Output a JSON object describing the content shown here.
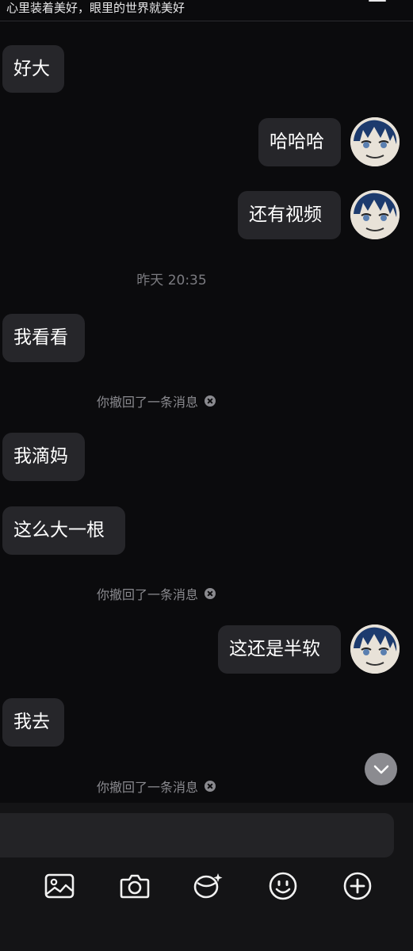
{
  "header": {
    "title": "心里装着美好，眼里的世界就美好"
  },
  "messages": [
    {
      "side": "left",
      "text": "好大"
    },
    {
      "side": "right",
      "text": "哈哈哈"
    },
    {
      "side": "right",
      "text": "还有视频"
    },
    {
      "type": "timestamp",
      "text": "昨天 20:35"
    },
    {
      "side": "left",
      "text": "我看看"
    },
    {
      "type": "system",
      "text": "你撤回了一条消息"
    },
    {
      "side": "left",
      "text": "我滴妈"
    },
    {
      "side": "left",
      "text": "这么大一根"
    },
    {
      "type": "system",
      "text": "你撤回了一条消息"
    },
    {
      "side": "right",
      "text": "这还是半软"
    },
    {
      "side": "left",
      "text": "我去"
    },
    {
      "type": "system",
      "text": "你撤回了一条消息"
    }
  ],
  "input": {
    "placeholder": ""
  },
  "toolbar": [
    "image-icon",
    "camera-icon",
    "sticker-icon",
    "emoji-icon",
    "plus-icon"
  ],
  "colors": {
    "background": "#0b0b0d",
    "bubble": "#26262a",
    "input_bar": "#141416",
    "muted_text": "#8a8a8f"
  }
}
